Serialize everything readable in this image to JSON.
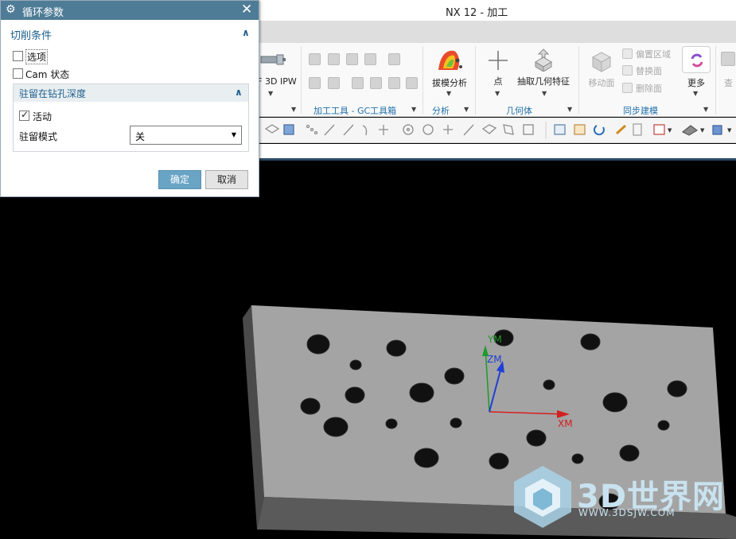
{
  "window": {
    "title": "NX 12 - 加工"
  },
  "ribbon": {
    "ipw_label": "3D IPW",
    "ipw_prefix": "F",
    "draft_analysis_label": "拔模分析",
    "point_label": "点",
    "extract_geometry_label": "抽取几何特征",
    "move_face_label": "移动面",
    "offset_region_label": "偏置区域",
    "replace_face_label": "替换面",
    "delete_face_label": "删除面",
    "more_label": "更多",
    "cut_label": "查",
    "groups": {
      "machining_tools": "加工工具 - GC工具箱",
      "analysis": "分析",
      "geometry": "几何体",
      "sync_modeling": "同步建模"
    }
  },
  "viewport": {
    "axis_x": "XM",
    "axis_y": "YM",
    "axis_z": "ZM"
  },
  "dialog": {
    "title": "循环参数",
    "cut_conditions": {
      "header": "切削条件",
      "options_label": "选项",
      "options_checked": false,
      "cam_status_label": "Cam 状态",
      "cam_status_checked": false
    },
    "dwell_group": {
      "header": "驻留在钻孔深度",
      "active_label": "活动",
      "active_checked": true,
      "dwell_mode_label": "驻留模式",
      "dwell_mode_value": "关"
    },
    "ok_label": "确定",
    "cancel_label": "取消"
  },
  "watermark": {
    "brand": "3D世界网",
    "url": "WWW.3DSJW.COM"
  },
  "colors": {
    "title_bar": "#4e7c97",
    "ok_button": "#6aa4c5",
    "section_header": "#1d5f8c",
    "axis_x": "#d42020",
    "axis_y": "#1f9a2a",
    "axis_z": "#1f3fd6",
    "part_top": "#a4a4a4",
    "part_front": "#5a5a5a"
  }
}
